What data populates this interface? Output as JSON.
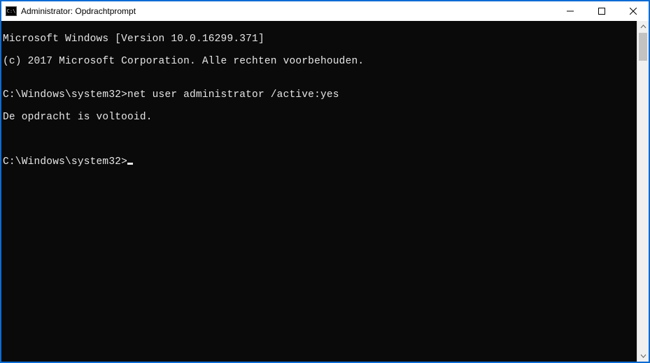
{
  "window": {
    "title": "Administrator: Opdrachtprompt"
  },
  "terminal": {
    "lines": {
      "l0": "Microsoft Windows [Version 10.0.16299.371]",
      "l1": "(c) 2017 Microsoft Corporation. Alle rechten voorbehouden.",
      "l2": "",
      "l3_prompt": "C:\\Windows\\system32>",
      "l3_cmd": "net user administrator /active:yes",
      "l4": "De opdracht is voltooid.",
      "l5": "",
      "l6": "",
      "l7_prompt": "C:\\Windows\\system32>"
    }
  }
}
